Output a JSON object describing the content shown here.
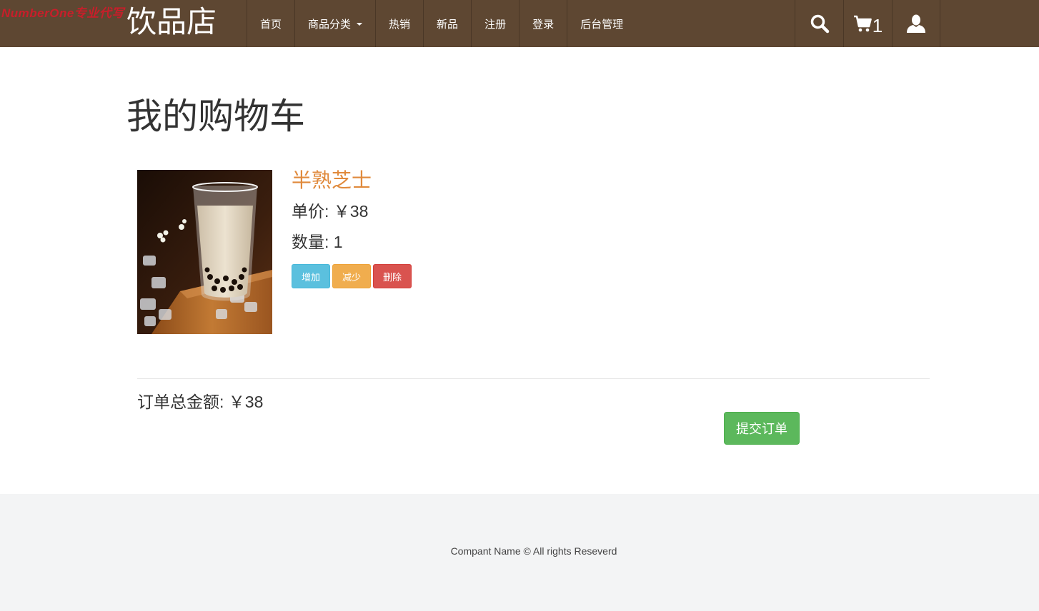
{
  "watermark": "NumberOne专业代写",
  "brand": "饮品店",
  "nav": {
    "items": [
      {
        "label": "首页"
      },
      {
        "label": "商品分类"
      },
      {
        "label": "热销"
      },
      {
        "label": "新品"
      },
      {
        "label": "注册"
      },
      {
        "label": "登录"
      },
      {
        "label": "后台管理"
      }
    ],
    "cart_count": "1",
    "icons": [
      "search-icon",
      "cart-icon",
      "user-icon"
    ]
  },
  "page_title": "我的购物车",
  "cart_item": {
    "name": "半熟芝士",
    "price_label": "单价: ￥38",
    "qty_label": "数量: 1",
    "buttons": {
      "increase": "增加",
      "decrease": "减少",
      "delete": "删除"
    }
  },
  "order": {
    "total_label": "订单总金额: ￥38",
    "submit_label": "提交订单"
  },
  "footer": {
    "text": "Compant Name © All rights Reseverd"
  },
  "colors": {
    "navbar": "#5e4732",
    "product_name": "#e08a3c",
    "info": "#5bc0de",
    "warning": "#f0ad4e",
    "danger": "#d9534f",
    "success": "#5cb85c",
    "footer_bg": "#f3f4f5"
  }
}
